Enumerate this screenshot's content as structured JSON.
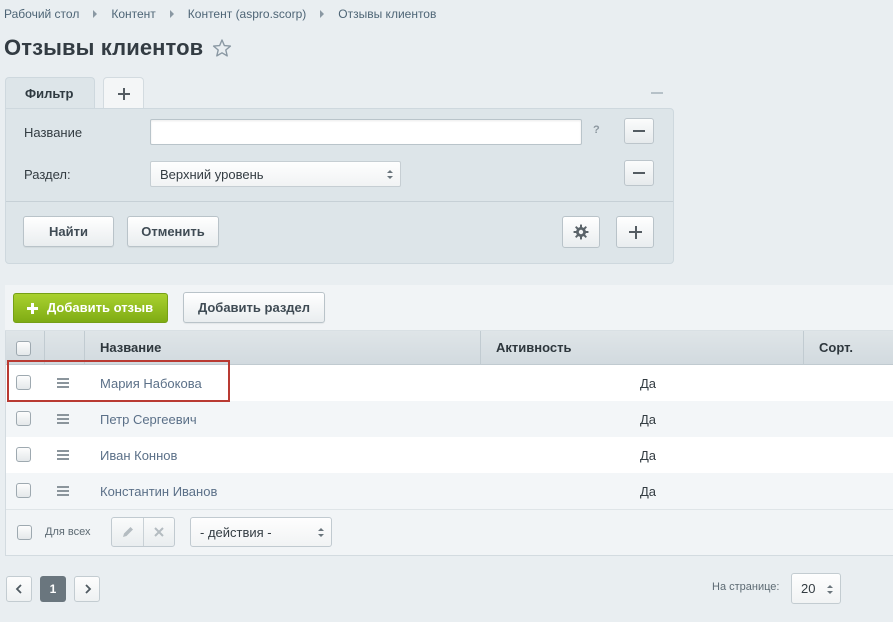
{
  "breadcrumb": [
    "Рабочий стол",
    "Контент",
    "Контент (aspro.scorp)",
    "Отзывы клиентов"
  ],
  "page": {
    "title": "Отзывы клиентов"
  },
  "filter": {
    "tab_label": "Фильтр",
    "name_label": "Название",
    "name_value": "",
    "help": "?",
    "section_label": "Раздел:",
    "section_value": "Верхний уровень",
    "find_label": "Найти",
    "cancel_label": "Отменить"
  },
  "toolbar": {
    "add_review_label": "Добавить отзыв",
    "add_section_label": "Добавить раздел"
  },
  "grid": {
    "columns": [
      "Название",
      "Активность",
      "Сорт."
    ],
    "rows": [
      {
        "name": "Мария Набокова",
        "active": "Да"
      },
      {
        "name": "Петр Сергеевич",
        "active": "Да"
      },
      {
        "name": "Иван Коннов",
        "active": "Да"
      },
      {
        "name": "Константин Иванов",
        "active": "Да"
      }
    ],
    "footer": {
      "for_all_label": "Для всех",
      "actions_value": "- действия -"
    }
  },
  "pagination": {
    "current_page": "1",
    "per_page_label": "На странице:",
    "per_page_value": "20"
  },
  "colors": {
    "accent_green": "#8cb81f",
    "highlight_red": "#b93a32",
    "link_blue": "#5b7088"
  }
}
